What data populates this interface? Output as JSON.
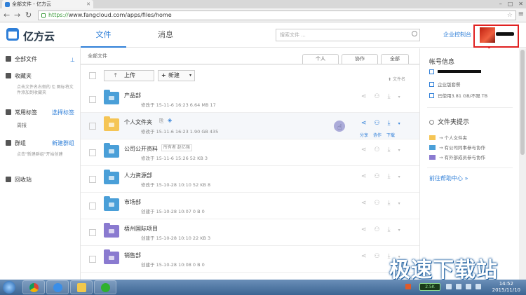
{
  "browser": {
    "tab_title": "全部文件 - 亿方云",
    "url_scheme": "https://",
    "url_rest": "www.fangcloud.com/apps/files/home"
  },
  "header": {
    "logo_text": "亿方云",
    "nav_files": "文件",
    "nav_messages": "消息",
    "search_placeholder": "搜索文件 ...",
    "console_link": "企业控制台"
  },
  "sidebar": {
    "all_files": "全部文件",
    "favorites": "收藏夹",
    "favorites_hint": "点击文件名右侧的 ⎘ 图标将文件添加到收藏夹",
    "tags": "常用标签",
    "tags_action": "选择标签",
    "tag_item": "周报",
    "groups": "群组",
    "groups_action": "新建群组",
    "groups_hint": "点击\"新建群组\"开始创建",
    "trash": "回收站"
  },
  "main": {
    "breadcrumb": "全部文件",
    "filters": [
      "个人",
      "协作",
      "全部"
    ],
    "upload": "上传",
    "new": "新建",
    "sort": "文件名",
    "rows": [
      {
        "name": "产品部",
        "meta": "修改于 15-11-6 16:23   6.64 MB   17",
        "color": "#4a9fd8",
        "tag": ""
      },
      {
        "name": "个人文件夹",
        "meta": "修改于 15-11-6 16:23   1.90 GB   435",
        "color": "#f5c555",
        "tag": ""
      },
      {
        "name": "公司公开资料",
        "meta": "修改于 15-11-6 15:26   52 KB   3",
        "color": "#4a9fd8",
        "tag": "所有者  赵亿强"
      },
      {
        "name": "人力资源部",
        "meta": "修改于 15-10-28 10:10   52 KB   8",
        "color": "#4a9fd8",
        "tag": ""
      },
      {
        "name": "市场部",
        "meta": "创建于 15-10-28 10:07   0 B   0",
        "color": "#4a9fd8",
        "tag": ""
      },
      {
        "name": "梧州国际项目",
        "meta": "创建于 15-10-28 10:10   22 KB   3",
        "color": "#8a7ad0",
        "tag": ""
      },
      {
        "name": "销售部",
        "meta": "创建于 15-10-28 10:08   0 B   0",
        "color": "#8a7ad0",
        "tag": ""
      }
    ],
    "hover_actions": [
      "分享",
      "协作",
      "下载"
    ]
  },
  "panel": {
    "account_title": "帐号信息",
    "plan": "企业版套餐",
    "usage": "已使用3.81 GB/不限 TB",
    "folder_tips_title": "文件夹提示",
    "legend": [
      "个人文件夹",
      "有公司同事参与协作",
      "有外部成员参与协作"
    ],
    "help_link": "前往帮助中心 »"
  },
  "watermark": "极速下载站",
  "taskbar": {
    "net": "2.5K",
    "time": "14:52",
    "date": "2015/11/10"
  },
  "colors": {
    "accent": "#2f7fd8",
    "folder_blue": "#4a9fd8",
    "folder_yellow": "#f5c555",
    "folder_purple": "#8a7ad0",
    "highlight_red": "#e02020"
  }
}
